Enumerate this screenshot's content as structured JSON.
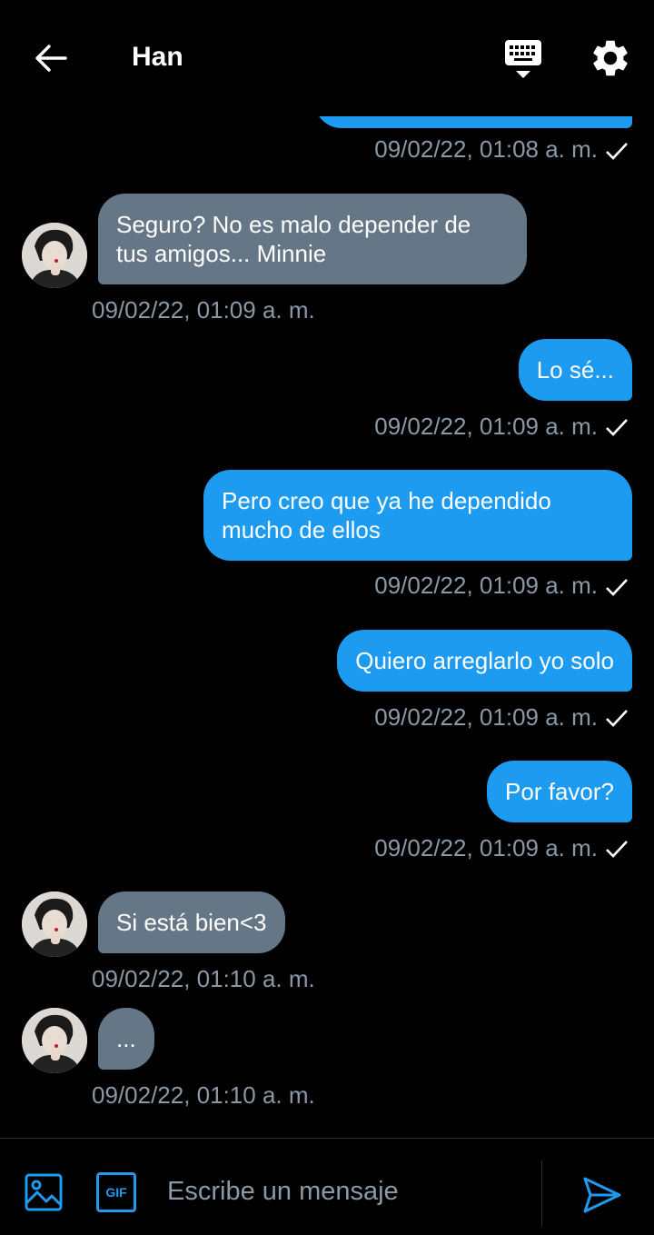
{
  "header": {
    "title": "Han",
    "icons": {
      "back": "arrow-left-icon",
      "keyboard": "keyboard-icon",
      "settings": "gear-icon"
    }
  },
  "messages": [
    {
      "from": "me",
      "text": "",
      "timestamp": "09/02/22, 01:08 a. m.",
      "read": true
    },
    {
      "from": "them",
      "lines": [
        "Seguro? No es malo depender de",
        "tus amigos... Minnie"
      ],
      "timestamp": "09/02/22, 01:09 a. m."
    },
    {
      "from": "me",
      "text": "Lo sé...",
      "timestamp": "09/02/22, 01:09 a. m.",
      "read": true
    },
    {
      "from": "me",
      "lines": [
        "Pero creo que ya he dependido",
        "mucho de ellos"
      ],
      "timestamp": "09/02/22, 01:09 a. m.",
      "read": true
    },
    {
      "from": "me",
      "text": "Quiero arreglarlo yo solo",
      "timestamp": "09/02/22, 01:09 a. m.",
      "read": true
    },
    {
      "from": "me",
      "text": "Por favor?",
      "timestamp": "09/02/22, 01:09 a. m.",
      "read": true
    },
    {
      "from": "them",
      "text": "Si está bien<3",
      "timestamp": "09/02/22, 01:10 a. m."
    },
    {
      "from": "them",
      "text": "...",
      "timestamp": "09/02/22, 01:10 a. m."
    }
  ],
  "composer": {
    "placeholder": "Escribe un mensaje",
    "gif_label": "GIF",
    "icons": {
      "image": "image-icon",
      "gif": "gif-icon",
      "send": "send-icon"
    }
  },
  "colors": {
    "background": "#000000",
    "my_bubble": "#1d9bf0",
    "their_bubble": "#657786",
    "timestamp": "#8b98a5",
    "accent": "#1d9bf0"
  }
}
